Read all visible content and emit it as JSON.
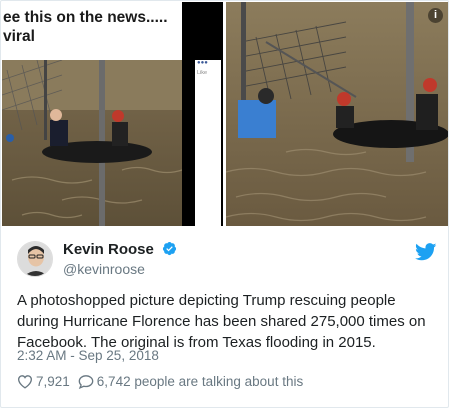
{
  "media": {
    "left_caption": "ee this on the news.....\nviral",
    "mini_panel_text": "Like",
    "info_icon": "info-icon"
  },
  "author": {
    "name": "Kevin Roose",
    "handle": "@kevinroose",
    "verified": true,
    "brand_icon": "twitter-bird-icon",
    "accent": "#1da1f2"
  },
  "tweet": {
    "text": "A photoshopped picture depicting Trump rescuing people during Hurricane Florence has been shared 275,000 times on Facebook. The original is from Texas flooding in 2015.",
    "timestamp": "2:32 AM - Sep 25, 2018"
  },
  "actions": {
    "likes": "7,921",
    "replies": "6,742 people are talking about this"
  }
}
